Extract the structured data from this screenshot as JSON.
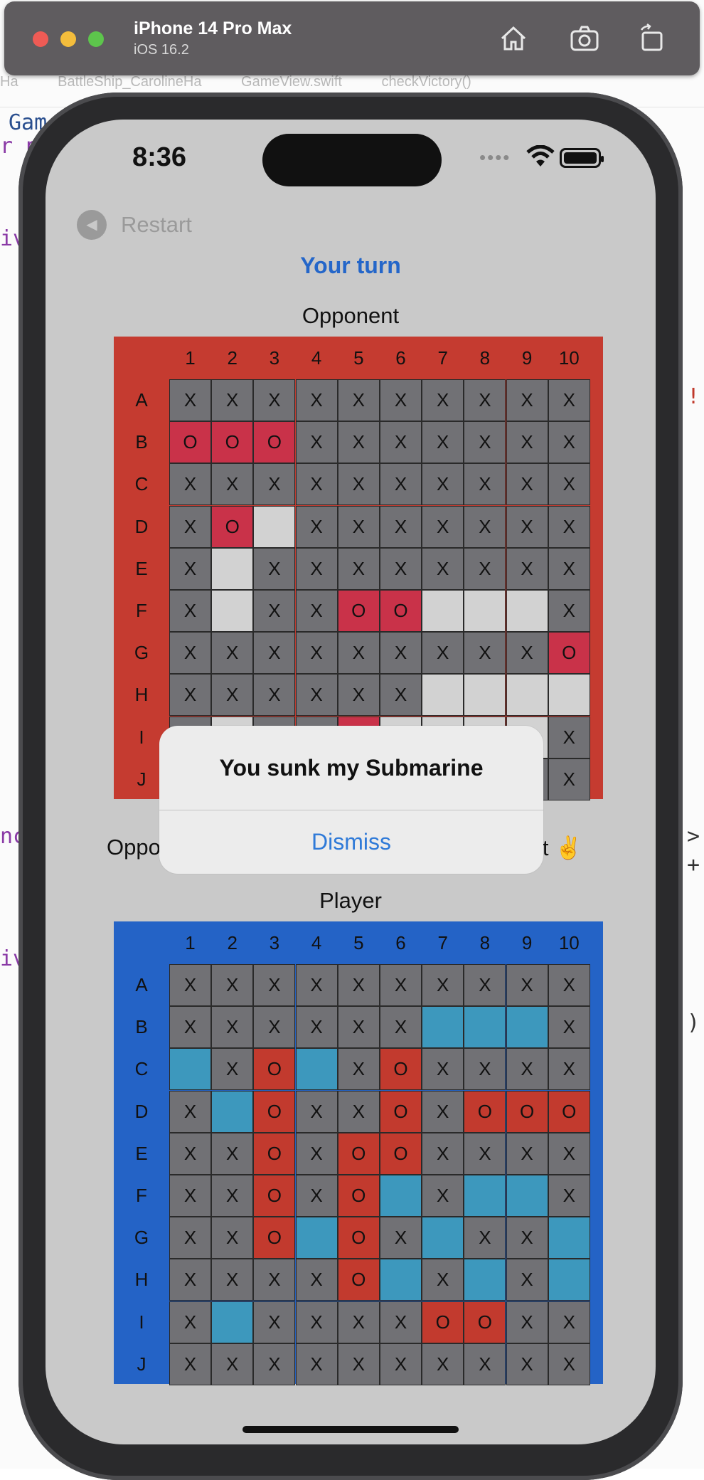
{
  "xcode": {
    "breadcrumb": [
      "Ha",
      "BattleShip_CarolineHa",
      "GameView.swift",
      "checkVictory()"
    ],
    "code_fragments": [
      "Gam",
      "r p",
      "iv",
      "!'",
      "nc",
      ">",
      "+",
      "iv",
      ")"
    ]
  },
  "simulator": {
    "title": "iPhone 14 Pro Max",
    "subtitle": "iOS 16.2",
    "icons": [
      "home-icon",
      "screenshot-icon",
      "rotate-icon"
    ]
  },
  "status_bar": {
    "time": "8:36"
  },
  "nav": {
    "restart_label": "Restart"
  },
  "turn_label": "Your turn",
  "opponent_board": {
    "title": "Opponent",
    "columns": [
      "1",
      "2",
      "3",
      "4",
      "5",
      "6",
      "7",
      "8",
      "9",
      "10"
    ],
    "rows": [
      "A",
      "B",
      "C",
      "D",
      "E",
      "F",
      "G",
      "H",
      "I",
      "J"
    ],
    "cells": [
      [
        "x",
        "x",
        "x",
        "x",
        "x",
        "x",
        "x",
        "x",
        "x",
        "x"
      ],
      [
        "p",
        "p",
        "p",
        "x",
        "x",
        "x",
        "x",
        "x",
        "x",
        "x"
      ],
      [
        "x",
        "x",
        "x",
        "x",
        "x",
        "x",
        "x",
        "x",
        "x",
        "x"
      ],
      [
        "x",
        "p",
        "e",
        "x",
        "x",
        "x",
        "x",
        "x",
        "x",
        "x"
      ],
      [
        "x",
        "e",
        "x",
        "x",
        "x",
        "x",
        "x",
        "x",
        "x",
        "x"
      ],
      [
        "x",
        "e",
        "x",
        "x",
        "p",
        "p",
        "e",
        "e",
        "e",
        "x"
      ],
      [
        "x",
        "x",
        "x",
        "x",
        "x",
        "x",
        "x",
        "x",
        "x",
        "p"
      ],
      [
        "x",
        "x",
        "x",
        "x",
        "x",
        "x",
        "e",
        "e",
        "e",
        "e"
      ],
      [
        "x",
        "e",
        "x",
        "x",
        "p",
        "e",
        "e",
        "e",
        "e",
        "x"
      ],
      [
        "x",
        "x",
        "x",
        "x",
        "x",
        "x",
        "x",
        "x",
        "x",
        "x"
      ]
    ]
  },
  "opponent_status": {
    "left": "Oppo",
    "right": "it ✌️"
  },
  "player_board": {
    "title": "Player",
    "columns": [
      "1",
      "2",
      "3",
      "4",
      "5",
      "6",
      "7",
      "8",
      "9",
      "10"
    ],
    "rows": [
      "A",
      "B",
      "C",
      "D",
      "E",
      "F",
      "G",
      "H",
      "I",
      "J"
    ],
    "cells": [
      [
        "x",
        "x",
        "x",
        "x",
        "x",
        "x",
        "x",
        "x",
        "x",
        "x"
      ],
      [
        "x",
        "x",
        "x",
        "x",
        "x",
        "x",
        "s",
        "s",
        "s",
        "x"
      ],
      [
        "s",
        "x",
        "r",
        "s",
        "x",
        "r",
        "x",
        "x",
        "x",
        "x"
      ],
      [
        "x",
        "s",
        "r",
        "x",
        "x",
        "r",
        "x",
        "r",
        "r",
        "r"
      ],
      [
        "x",
        "x",
        "r",
        "x",
        "r",
        "r",
        "x",
        "x",
        "x",
        "x"
      ],
      [
        "x",
        "x",
        "r",
        "x",
        "r",
        "s",
        "x",
        "s",
        "s",
        "x"
      ],
      [
        "x",
        "x",
        "r",
        "s",
        "r",
        "x",
        "s",
        "x",
        "x",
        "s"
      ],
      [
        "x",
        "x",
        "x",
        "x",
        "r",
        "s",
        "x",
        "s",
        "x",
        "s"
      ],
      [
        "x",
        "s",
        "x",
        "x",
        "x",
        "x",
        "r",
        "r",
        "x",
        "x"
      ],
      [
        "x",
        "x",
        "x",
        "x",
        "x",
        "x",
        "x",
        "x",
        "x",
        "x"
      ]
    ]
  },
  "cell_text": {
    "miss": "X",
    "hit": "O"
  },
  "alert": {
    "title": "You sunk my Submarine",
    "button": "Dismiss"
  },
  "colors": {
    "opponent_board": "#c53b30",
    "player_board": "#2463c6",
    "turn_label": "#2466c9",
    "alert_button": "#2f7ad8"
  }
}
